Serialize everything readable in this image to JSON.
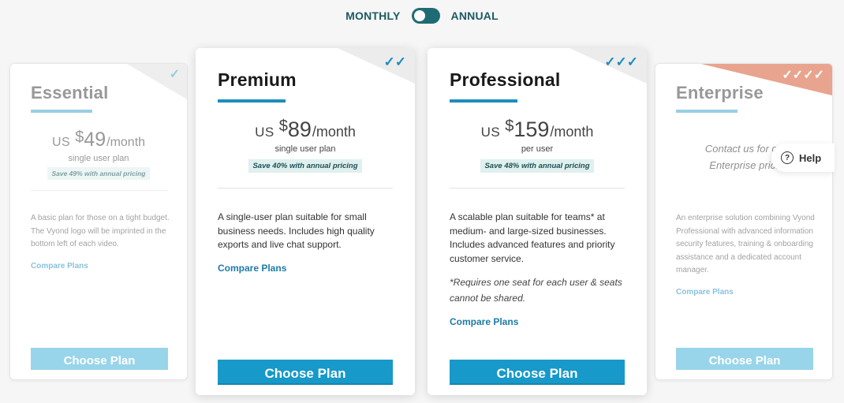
{
  "billing_toggle": {
    "left_label": "MONTHLY",
    "right_label": "ANNUAL"
  },
  "colors": {
    "accent": "#1d8dbf",
    "button": "#1799c9",
    "toggle": "#1f6b73",
    "enterprise_corner": "#e8a48e",
    "save_badge_bg": "#dff0ee"
  },
  "plans": {
    "essential": {
      "name": "Essential",
      "currency": "US",
      "symbol": "$",
      "amount": "49",
      "period": "/month",
      "subtitle": "single user plan",
      "save": "Save 49% with annual pricing",
      "description": "A basic plan for those on a tight budget. The Vyond logo will be imprinted in the bottom left of each video.",
      "compare": "Compare Plans",
      "cta": "Choose Plan",
      "checks": "✓"
    },
    "premium": {
      "name": "Premium",
      "currency": "US",
      "symbol": "$",
      "amount": "89",
      "period": "/month",
      "subtitle": "single user plan",
      "save": "Save 40% with annual pricing",
      "description": "A single-user plan suitable for small business needs. Includes high quality exports and live chat support.",
      "compare": "Compare Plans",
      "cta": "Choose Plan",
      "checks": "✓✓"
    },
    "professional": {
      "name": "Professional",
      "currency": "US",
      "symbol": "$",
      "amount": "159",
      "period": "/month",
      "subtitle": "per user",
      "save": "Save 48% with annual pricing",
      "description": "A scalable plan suitable for teams* at medium- and large-sized businesses. Includes advanced features and priority customer service.",
      "note": "*Requires one seat for each user & seats cannot be shared.",
      "compare": "Compare Plans",
      "cta": "Choose Plan",
      "checks": "✓✓✓"
    },
    "enterprise": {
      "name": "Enterprise",
      "contact_line1": "Contact us for cu",
      "contact_line2": "Enterprise pric.",
      "description": "An enterprise solution combining Vyond Professional with advanced information security features, training & onboarding assistance and a dedicated account manager.",
      "compare": "Compare Plans",
      "cta": "Choose Plan",
      "checks": "✓✓✓✓"
    }
  },
  "help": {
    "icon": "?",
    "label": "Help"
  }
}
